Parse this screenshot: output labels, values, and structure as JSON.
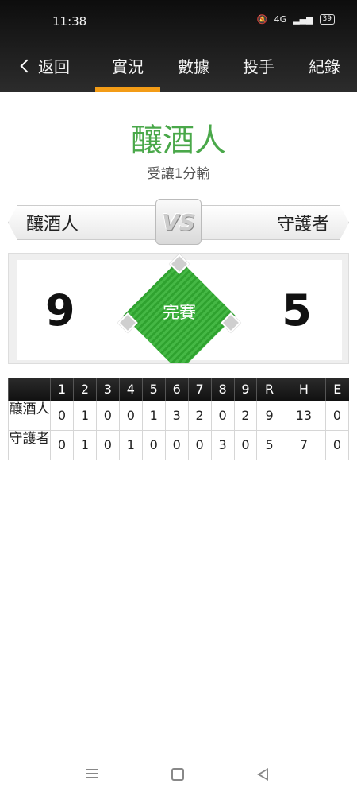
{
  "status_bar": {
    "time": "11:38",
    "network": "4G",
    "battery": "39"
  },
  "nav": {
    "back_label": "返回",
    "tabs": [
      {
        "label": "實況",
        "active": true
      },
      {
        "label": "數據",
        "active": false
      },
      {
        "label": "投手",
        "active": false
      },
      {
        "label": "紀錄",
        "active": false
      }
    ],
    "active_color": "#f39c16"
  },
  "game": {
    "winner_team": "釀酒人",
    "result_text": "受讓1分輸",
    "away_team": "釀酒人",
    "home_team": "守護者",
    "vs_label": "VS",
    "away_score": "9",
    "home_score": "5",
    "status": "完賽"
  },
  "linescore": {
    "headers": [
      "",
      "1",
      "2",
      "3",
      "4",
      "5",
      "6",
      "7",
      "8",
      "9",
      "R",
      "H",
      "E"
    ],
    "rows": [
      {
        "team": "釀酒人",
        "cells": [
          "0",
          "1",
          "0",
          "0",
          "1",
          "3",
          "2",
          "0",
          "2",
          "9",
          "13",
          "0"
        ]
      },
      {
        "team": "守護者",
        "cells": [
          "0",
          "1",
          "0",
          "1",
          "0",
          "0",
          "0",
          "3",
          "0",
          "5",
          "7",
          "0"
        ]
      }
    ]
  },
  "colors": {
    "title_green": "#4aa84a",
    "field_green": "#2fa22f"
  }
}
